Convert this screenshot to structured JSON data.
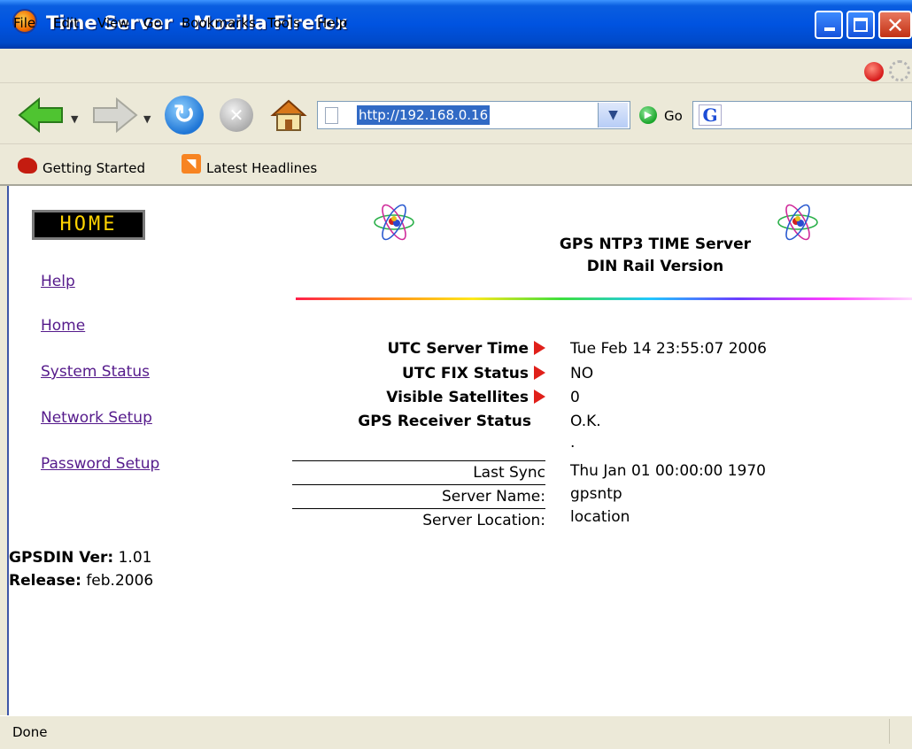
{
  "window": {
    "title": "Time Server - Mozilla Firefox"
  },
  "menu": [
    {
      "label": "File"
    },
    {
      "label": "Edit"
    },
    {
      "label": "View"
    },
    {
      "label": "Go"
    },
    {
      "label": "Bookmarks"
    },
    {
      "label": "Tools"
    },
    {
      "label": "Help"
    }
  ],
  "toolbar": {
    "url": "http://192.168.0.16",
    "go_label": "Go",
    "search_logo": "G"
  },
  "bookmarks": [
    {
      "label": "Getting Started",
      "icon": "firefox-icon"
    },
    {
      "label": "Latest Headlines",
      "icon": "rss-icon"
    }
  ],
  "page": {
    "home_badge": "HOME",
    "nav_links": [
      "Help",
      "Home",
      "System Status",
      "Network Setup",
      "Password Setup"
    ],
    "version_label": "GPSDIN Ver:",
    "version_value": "1.01",
    "release_label": "Release:",
    "release_value": "feb.2006",
    "heading_line1": "GPS NTP3 TIME Server",
    "heading_line2": "DIN Rail Version",
    "status_rows": [
      {
        "label": "UTC Server Time",
        "value": "Tue Feb 14 23:55:07 2006"
      },
      {
        "label": "UTC FIX Status",
        "value": "NO"
      },
      {
        "label": "Visible Satellites",
        "value": "0"
      },
      {
        "label": "GPS Receiver Status",
        "value": "O.K."
      }
    ],
    "dot": ".",
    "info_rows": [
      {
        "label": "Last Sync",
        "value": "Thu Jan 01 00:00:00 1970"
      },
      {
        "label": "Server Name:",
        "value": "gpsntp"
      },
      {
        "label": "Server Location:",
        "value": "location"
      }
    ]
  },
  "status_bar": {
    "text": "Done"
  }
}
